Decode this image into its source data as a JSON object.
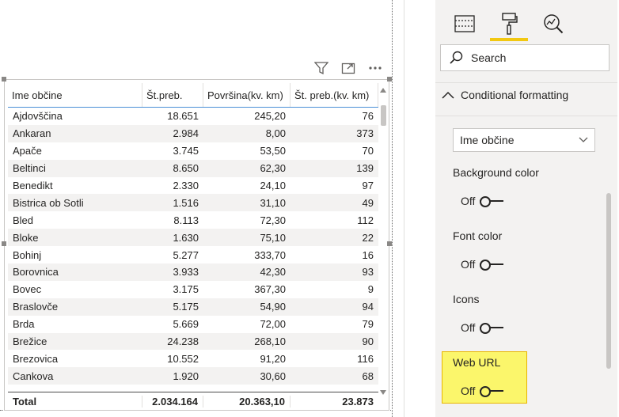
{
  "visual_header": {
    "filter_icon": "filter-icon",
    "focus_icon": "focus-mode-icon",
    "more_icon": "more-options-icon"
  },
  "table": {
    "columns": [
      "Ime občine",
      "Št.preb.",
      "Površina(kv. km)",
      "Št. preb.(kv. km)"
    ],
    "rows": [
      [
        "Ajdovščina",
        "18.651",
        "245,20",
        "76"
      ],
      [
        "Ankaran",
        "2.984",
        "8,00",
        "373"
      ],
      [
        "Apače",
        "3.745",
        "53,50",
        "70"
      ],
      [
        "Beltinci",
        "8.650",
        "62,30",
        "139"
      ],
      [
        "Benedikt",
        "2.330",
        "24,10",
        "97"
      ],
      [
        "Bistrica ob Sotli",
        "1.516",
        "31,10",
        "49"
      ],
      [
        "Bled",
        "8.113",
        "72,30",
        "112"
      ],
      [
        "Bloke",
        "1.630",
        "75,10",
        "22"
      ],
      [
        "Bohinj",
        "5.277",
        "333,70",
        "16"
      ],
      [
        "Borovnica",
        "3.933",
        "42,30",
        "93"
      ],
      [
        "Bovec",
        "3.175",
        "367,30",
        "9"
      ],
      [
        "Braslovče",
        "5.175",
        "54,90",
        "94"
      ],
      [
        "Brda",
        "5.669",
        "72,00",
        "79"
      ],
      [
        "Brežice",
        "24.238",
        "268,10",
        "90"
      ],
      [
        "Brezovica",
        "10.552",
        "91,20",
        "116"
      ],
      [
        "Cankova",
        "1.920",
        "30,60",
        "68"
      ]
    ],
    "total": {
      "label": "Total",
      "pop": "2.034.164",
      "area": "20.363,10",
      "density": "23.873"
    }
  },
  "pane": {
    "tabs": [
      {
        "name": "fields-tab",
        "icon": "table-fields-icon"
      },
      {
        "name": "format-tab",
        "icon": "paint-roller-icon",
        "active": true
      },
      {
        "name": "analytics-tab",
        "icon": "analytics-magnifier-icon"
      }
    ],
    "search_label": "Search",
    "section_title": "Conditional formatting",
    "field_dropdown": "Ime občine",
    "properties": [
      {
        "label": "Background color",
        "state": "Off"
      },
      {
        "label": "Font color",
        "state": "Off"
      },
      {
        "label": "Icons",
        "state": "Off"
      },
      {
        "label": "Web URL",
        "state": "Off"
      }
    ],
    "highlight_color": "#fbf66b",
    "accent_color": "#f2c811"
  }
}
